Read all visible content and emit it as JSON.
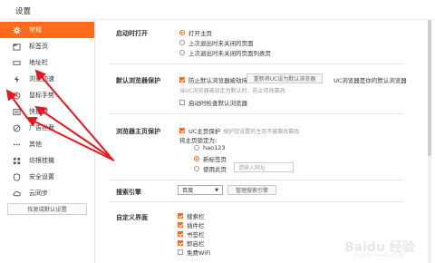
{
  "window": {
    "title": "设置"
  },
  "sidebar": {
    "items": [
      {
        "label": "常规",
        "icon": "gear-icon",
        "active": true
      },
      {
        "label": "标签页",
        "icon": "tab-icon"
      },
      {
        "label": "地址栏",
        "icon": "address-bar-icon"
      },
      {
        "label": "浏览加速",
        "icon": "lightning-icon"
      },
      {
        "label": "鼠标手势",
        "icon": "mouse-gesture-icon"
      },
      {
        "label": "快捷键",
        "icon": "keyboard-icon"
      },
      {
        "label": "广告拦截",
        "icon": "block-icon"
      },
      {
        "label": "其他",
        "icon": "more-icon"
      },
      {
        "label": "坊根桂機",
        "icon": "grid-icon"
      },
      {
        "label": "安全设置",
        "icon": "shield-icon"
      },
      {
        "label": "云同步",
        "icon": "cloud-icon"
      }
    ],
    "restore_label": "恢复成默认设置"
  },
  "startup": {
    "label": "启动时打开",
    "options": [
      {
        "label": "打开主页",
        "selected": true
      },
      {
        "label": "上次退出时未关闭的页面",
        "selected": false
      },
      {
        "label": "上次退出时未关闭的页面列表页",
        "selected": false
      }
    ]
  },
  "default_browser": {
    "label": "默认浏览器保护",
    "checkbox_label": "防止默认浏览器被劫持",
    "button_label": "重新将UC设为默认浏览器",
    "status_text": "UC浏览器是你的默认浏览器",
    "note_text": "当UC浏览器被劫走为默认时，防止修改篡改",
    "startup_check_label": "启动时检查默认浏览器"
  },
  "homepage": {
    "label": "浏览器主页保护",
    "protect_label": "UC主页保护",
    "protect_note": "保护您设置的主页不被篡改篡改",
    "set_label": "将主页锁定为:",
    "options": [
      {
        "label": "hao123",
        "selected": false
      },
      {
        "label": "新标签页",
        "selected": true
      },
      {
        "label": "使用此页",
        "selected": false
      }
    ],
    "url_placeholder": "请输入网址"
  },
  "search": {
    "label": "搜索引擎",
    "engine": "百度",
    "manage_label": "管理搜索引擎"
  },
  "custom_ui": {
    "label": "自定义界面",
    "items": [
      {
        "label": "搜索栏",
        "checked": true
      },
      {
        "label": "插件栏",
        "checked": true
      },
      {
        "label": "书签栏",
        "checked": true
      },
      {
        "label": "即启栏",
        "checked": true
      },
      {
        "label": "免费WiFi",
        "checked": false
      }
    ]
  },
  "watermark": {
    "text": "Baidu 经验",
    "sub": "jingyan.baidu.com"
  },
  "colors": {
    "accent": "#ff6b1a",
    "arrow": "#e8171f"
  }
}
